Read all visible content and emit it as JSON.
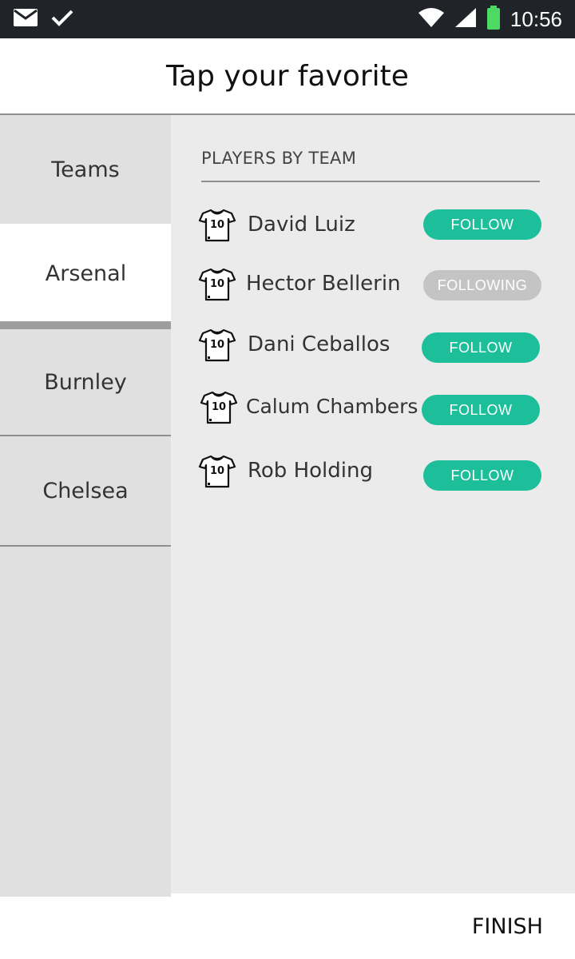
{
  "status_bar": {
    "time": "10:56",
    "icons": [
      "mail-icon",
      "check-icon",
      "wifi-icon",
      "signal-icon",
      "battery-icon"
    ],
    "battery_color": "#4cd964"
  },
  "header": {
    "title": "Tap your favorite"
  },
  "sidebar": {
    "items": [
      {
        "label": "Teams",
        "selected": false
      },
      {
        "label": "Arsenal",
        "selected": true
      },
      {
        "label": "Burnley",
        "selected": false
      },
      {
        "label": "Chelsea",
        "selected": false
      }
    ]
  },
  "main": {
    "section_title": "PLAYERS BY TEAM",
    "players": [
      {
        "name": "David Luiz",
        "button": "FOLLOW",
        "state": "follow",
        "icon": "jersey-10-icon"
      },
      {
        "name": "Hector Bellerin",
        "button": "FOLLOWING",
        "state": "following",
        "icon": "jersey-10-icon"
      },
      {
        "name": "Dani Ceballos",
        "button": "FOLLOW",
        "state": "follow",
        "icon": "jersey-10-icon"
      },
      {
        "name": "Calum Chambers",
        "button": "FOLLOW",
        "state": "follow",
        "icon": "jersey-10-icon"
      },
      {
        "name": "Rob Holding",
        "button": "FOLLOW",
        "state": "follow",
        "icon": "jersey-10-icon"
      }
    ],
    "jersey_number": "10"
  },
  "footer": {
    "finish_label": "FINISH"
  },
  "colors": {
    "accent": "#1dbf9b",
    "following": "#c4c4c4",
    "statusbar": "#202428"
  }
}
